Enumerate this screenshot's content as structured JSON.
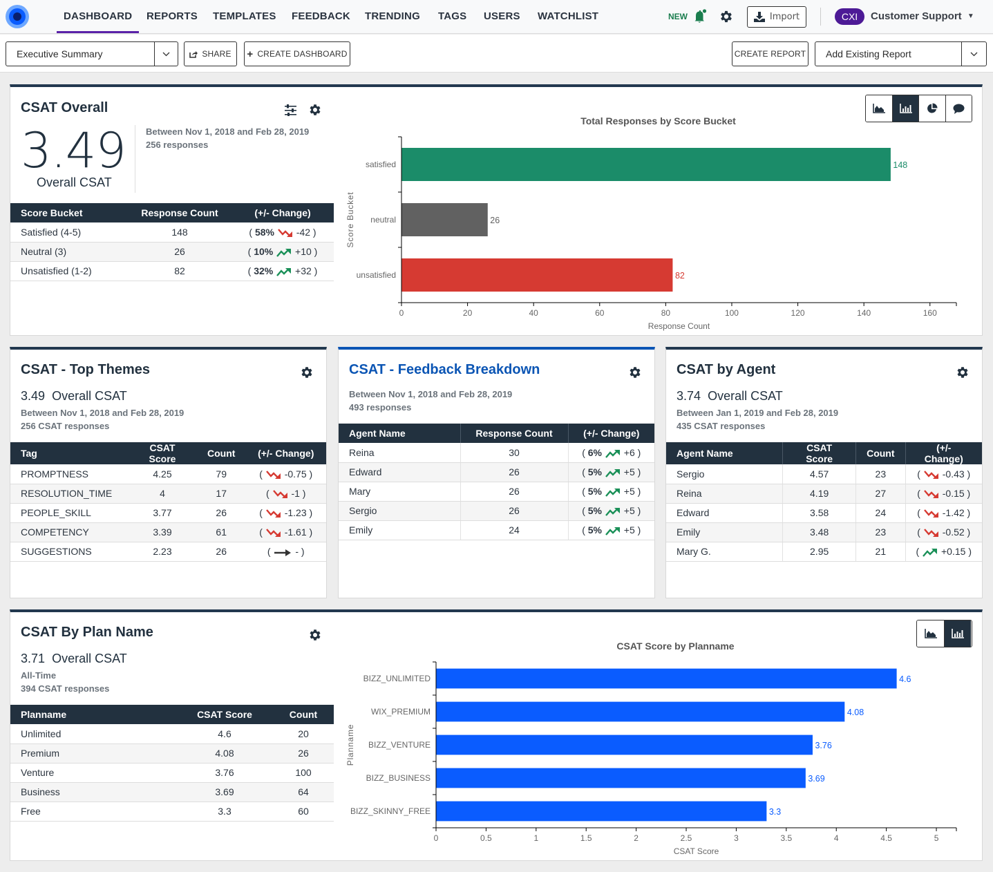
{
  "nav": {
    "items": [
      "DASHBOARD",
      "REPORTS",
      "TEMPLATES",
      "FEEDBACK",
      "TRENDING",
      "TAGS",
      "USERS",
      "WATCHLIST"
    ],
    "active": "DASHBOARD",
    "new_label": "NEW",
    "import_label": "Import",
    "org_badge": "CXI",
    "org_name": "Customer Support",
    "icons": [
      "logo",
      "bell-icon",
      "gear-icon",
      "download-icon",
      "caret-down-icon"
    ]
  },
  "toolbar": {
    "dashboard_select": "Executive Summary",
    "share_label": "SHARE",
    "create_dashboard_label": "CREATE DASHBOARD",
    "create_report_label": "CREATE REPORT",
    "add_existing_label": "Add Existing Report"
  },
  "csat_overall": {
    "title": "CSAT Overall",
    "score": "3.49",
    "score_label": "Overall CSAT",
    "date_range": "Between Nov 1, 2018 and Feb 28, 2019",
    "responses": "256 responses",
    "table": {
      "headers": [
        "Score Bucket",
        "Response Count",
        "(+/- Change)"
      ],
      "rows": [
        {
          "bucket": "Satisfied (4-5)",
          "count": "148",
          "pct": "58%",
          "trend": "down",
          "delta": "-42"
        },
        {
          "bucket": "Neutral (3)",
          "count": "26",
          "pct": "10%",
          "trend": "up",
          "delta": "+10"
        },
        {
          "bucket": "Unsatisfied (1-2)",
          "count": "82",
          "pct": "32%",
          "trend": "up",
          "delta": "+32"
        }
      ]
    },
    "chart_toggle": [
      "area-chart",
      "bar-chart",
      "pie-chart",
      "comment"
    ],
    "chart_toggle_active": "bar-chart"
  },
  "top_themes": {
    "title": "CSAT - Top Themes",
    "score": "3.49",
    "score_label": "Overall CSAT",
    "date_range": "Between Nov 1, 2018 and Feb 28, 2019",
    "responses": "256 CSAT responses",
    "headers": [
      "Tag",
      "CSAT Score",
      "Count",
      "(+/- Change)"
    ],
    "rows": [
      {
        "tag": "PROMPTNESS",
        "score": "4.25",
        "count": "79",
        "trend": "down",
        "delta": "-0.75"
      },
      {
        "tag": "RESOLUTION_TIME",
        "score": "4",
        "count": "17",
        "trend": "down",
        "delta": "-1"
      },
      {
        "tag": "PEOPLE_SKILL",
        "score": "3.77",
        "count": "26",
        "trend": "down",
        "delta": "-1.23"
      },
      {
        "tag": "COMPETENCY",
        "score": "3.39",
        "count": "61",
        "trend": "down",
        "delta": "-1.61"
      },
      {
        "tag": "SUGGESTIONS",
        "score": "2.23",
        "count": "26",
        "trend": "flat",
        "delta": "-"
      }
    ]
  },
  "feedback_breakdown": {
    "title": "CSAT - Feedback Breakdown",
    "date_range": "Between Nov 1, 2018 and Feb 28, 2019",
    "responses": "493 responses",
    "headers": [
      "Agent Name",
      "Response Count",
      "(+/- Change)"
    ],
    "rows": [
      {
        "name": "Reina",
        "count": "30",
        "pct": "6%",
        "trend": "up",
        "delta": "+6"
      },
      {
        "name": "Edward",
        "count": "26",
        "pct": "5%",
        "trend": "up",
        "delta": "+5"
      },
      {
        "name": "Mary",
        "count": "26",
        "pct": "5%",
        "trend": "up",
        "delta": "+5"
      },
      {
        "name": "Sergio",
        "count": "26",
        "pct": "5%",
        "trend": "up",
        "delta": "+5"
      },
      {
        "name": "Emily",
        "count": "24",
        "pct": "5%",
        "trend": "up",
        "delta": "+5"
      }
    ]
  },
  "by_agent": {
    "title": "CSAT by Agent",
    "score": "3.74",
    "score_label": "Overall CSAT",
    "date_range": "Between Jan 1, 2019 and Feb 28, 2019",
    "responses": "435 CSAT responses",
    "headers": [
      "Agent Name",
      "CSAT Score",
      "Count",
      "(+/- Change)"
    ],
    "rows": [
      {
        "name": "Sergio",
        "score": "4.57",
        "count": "23",
        "trend": "down",
        "delta": "-0.43"
      },
      {
        "name": "Reina",
        "score": "4.19",
        "count": "27",
        "trend": "down",
        "delta": "-0.15"
      },
      {
        "name": "Edward",
        "score": "3.58",
        "count": "24",
        "trend": "down",
        "delta": "-1.42"
      },
      {
        "name": "Emily",
        "score": "3.48",
        "count": "23",
        "trend": "down",
        "delta": "-0.52"
      },
      {
        "name": "Mary G.",
        "score": "2.95",
        "count": "21",
        "trend": "up",
        "delta": "+0.15"
      }
    ]
  },
  "by_plan": {
    "title": "CSAT By Plan Name",
    "score": "3.71",
    "score_label": "Overall CSAT",
    "date_range": "All-Time",
    "responses": "394 CSAT responses",
    "headers": [
      "Planname",
      "CSAT Score",
      "Count"
    ],
    "rows": [
      {
        "plan": "Unlimited",
        "score": "4.6",
        "count": "20"
      },
      {
        "plan": "Premium",
        "score": "4.08",
        "count": "26"
      },
      {
        "plan": "Venture",
        "score": "3.76",
        "count": "100"
      },
      {
        "plan": "Business",
        "score": "3.69",
        "count": "64"
      },
      {
        "plan": "Free",
        "score": "3.3",
        "count": "60"
      }
    ],
    "chart_toggle": [
      "area-chart",
      "bar-chart"
    ],
    "chart_toggle_active": "bar-chart"
  },
  "colors": {
    "satisfied": "#1b8c69",
    "neutral": "#616161",
    "unsatisfied": "#d63a32",
    "plan_bar": "#0a5cff",
    "trend_up": "#1a9058",
    "trend_down": "#d63a32",
    "header_dark": "#22313f",
    "accent_purple": "#5a22a8"
  },
  "chart_data": [
    {
      "type": "bar",
      "orientation": "horizontal",
      "title": "Total Responses by Score Bucket",
      "xlabel": "Response Count",
      "ylabel": "Score Bucket",
      "categories": [
        "satisfied",
        "neutral",
        "unsatisfied"
      ],
      "values": [
        148,
        26,
        82
      ],
      "bar_colors": [
        "#1b8c69",
        "#616161",
        "#d63a32"
      ],
      "xlim": [
        0,
        168
      ],
      "xticks": [
        0,
        20,
        40,
        60,
        80,
        100,
        120,
        140,
        160
      ],
      "grid": false,
      "data_labels": true
    },
    {
      "type": "bar",
      "orientation": "horizontal",
      "title": "CSAT Score by Planname",
      "xlabel": "CSAT Score",
      "ylabel": "Planname",
      "categories": [
        "BIZZ_UNLIMITED",
        "WIX_PREMIUM",
        "BIZZ_VENTURE",
        "BIZZ_BUSINESS",
        "BIZZ_SKINNY_FREE"
      ],
      "values": [
        4.6,
        4.08,
        3.76,
        3.69,
        3.3
      ],
      "bar_colors": [
        "#0a5cff"
      ],
      "xlim": [
        0,
        5.2
      ],
      "xticks": [
        0,
        0.5,
        1,
        1.5,
        2,
        2.5,
        3,
        3.5,
        4,
        4.5,
        5
      ],
      "grid": false,
      "data_labels": true
    }
  ]
}
